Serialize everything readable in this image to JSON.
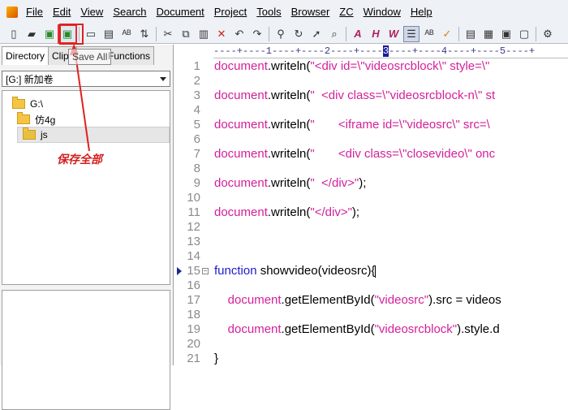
{
  "menu": [
    "File",
    "Edit",
    "View",
    "Search",
    "Document",
    "Project",
    "Tools",
    "Browser",
    "ZC",
    "Window",
    "Help"
  ],
  "toolbar": {
    "icons": [
      "new-file-icon",
      "open-folder-icon",
      "save-icon",
      "save-all-icon",
      "print-preview-icon",
      "print-icon",
      "spell-check-icon",
      "file-transfer-icon",
      "cut-icon",
      "copy-icon",
      "paste-icon",
      "delete-icon",
      "undo-icon",
      "redo-icon",
      "find-icon",
      "replace-icon",
      "goto-icon",
      "find-in-files-icon",
      "font-a-icon",
      "hex-icon",
      "word-wrap-icon",
      "indent-icon",
      "spell-icon",
      "check-icon",
      "list-icon",
      "tag-icon",
      "box-icon",
      "window-icon",
      "settings-icon"
    ]
  },
  "tooltip": "Save All",
  "left_panel": {
    "tabs": [
      "Directory",
      "Clip",
      "Functions"
    ],
    "drive": "[G:] 新加卷",
    "tree": [
      "G:\\",
      "仿4g",
      "js"
    ]
  },
  "annotation": "保存全部",
  "editor": {
    "ruler": "----+----1----+----2----+----3----+----4----+----5----+",
    "lines": [
      {
        "n": "1",
        "parts": [
          {
            "t": "document",
            "c": "kw"
          },
          {
            "t": ".writeln(",
            "c": ""
          },
          {
            "t": "\"<div id=\\\"videosrcblock\\\" style=\\\"",
            "c": "str"
          }
        ]
      },
      {
        "n": "2",
        "parts": []
      },
      {
        "n": "3",
        "parts": [
          {
            "t": "document",
            "c": "kw"
          },
          {
            "t": ".writeln(",
            "c": ""
          },
          {
            "t": "\"  <div class=\\\"videosrcblock-n\\\" st",
            "c": "str"
          }
        ]
      },
      {
        "n": "4",
        "parts": []
      },
      {
        "n": "5",
        "parts": [
          {
            "t": "document",
            "c": "kw"
          },
          {
            "t": ".writeln(",
            "c": ""
          },
          {
            "t": "\"       <iframe id=\\\"videosrc\\\" src=\\",
            "c": "str"
          }
        ]
      },
      {
        "n": "6",
        "parts": []
      },
      {
        "n": "7",
        "parts": [
          {
            "t": "document",
            "c": "kw"
          },
          {
            "t": ".writeln(",
            "c": ""
          },
          {
            "t": "\"       <div class=\\\"closevideo\\\" onc",
            "c": "str"
          }
        ]
      },
      {
        "n": "8",
        "parts": []
      },
      {
        "n": "9",
        "parts": [
          {
            "t": "document",
            "c": "kw"
          },
          {
            "t": ".writeln(",
            "c": ""
          },
          {
            "t": "\"  </div>\"",
            "c": "str"
          },
          {
            "t": ");",
            "c": ""
          }
        ]
      },
      {
        "n": "10",
        "parts": []
      },
      {
        "n": "11",
        "parts": [
          {
            "t": "document",
            "c": "kw"
          },
          {
            "t": ".writeln(",
            "c": ""
          },
          {
            "t": "\"</div>\"",
            "c": "str"
          },
          {
            "t": ");",
            "c": ""
          }
        ]
      },
      {
        "n": "12",
        "parts": []
      },
      {
        "n": "13",
        "parts": []
      },
      {
        "n": "14",
        "parts": []
      },
      {
        "n": "15",
        "parts": [
          {
            "t": "function",
            "c": "fn-kw"
          },
          {
            "t": " showvideo(videosrc){",
            "c": ""
          }
        ]
      },
      {
        "n": "16",
        "parts": []
      },
      {
        "n": "17",
        "parts": [
          {
            "t": "    document",
            "c": "kw"
          },
          {
            "t": ".getElementById(",
            "c": ""
          },
          {
            "t": "\"videosrc\"",
            "c": "str"
          },
          {
            "t": ").src = videos",
            "c": ""
          }
        ]
      },
      {
        "n": "18",
        "parts": []
      },
      {
        "n": "19",
        "parts": [
          {
            "t": "    document",
            "c": "kw"
          },
          {
            "t": ".getElementById(",
            "c": ""
          },
          {
            "t": "\"videosrcblock\"",
            "c": "str"
          },
          {
            "t": ").style.d",
            "c": ""
          }
        ]
      },
      {
        "n": "20",
        "parts": []
      },
      {
        "n": "21",
        "parts": [
          {
            "t": "}",
            "c": ""
          }
        ]
      }
    ]
  },
  "colors": {
    "keyword": "#d4209a",
    "function_keyword": "#1a1ad0",
    "annotation": "#d42020"
  }
}
